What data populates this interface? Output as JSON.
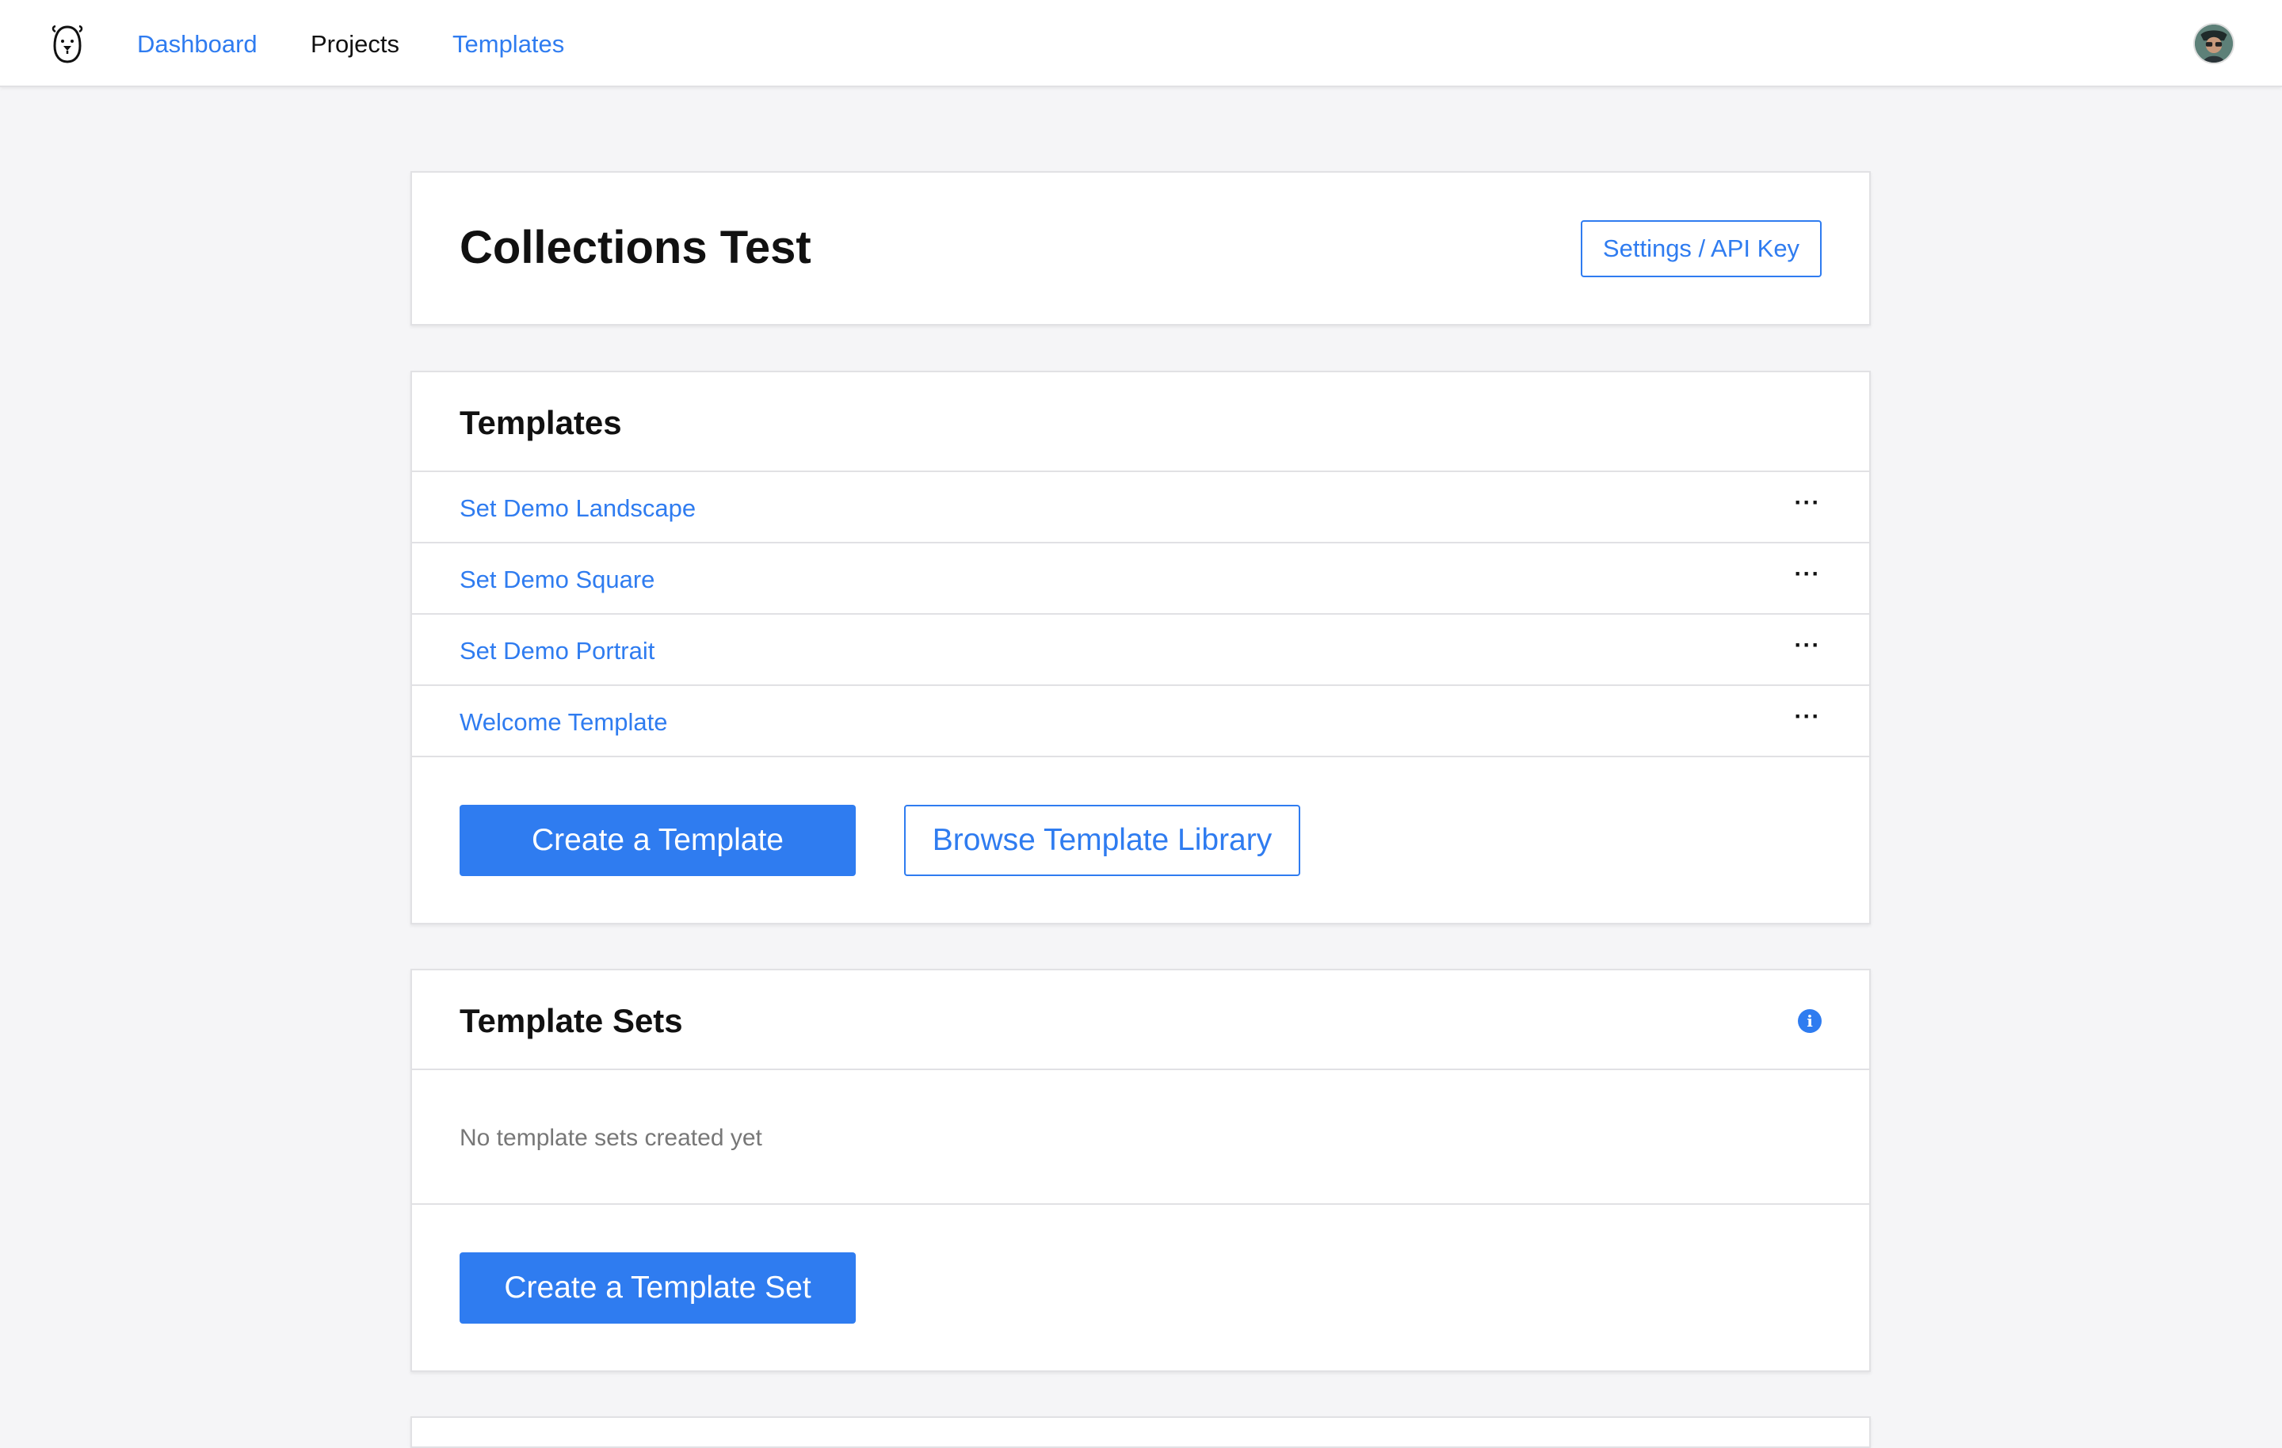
{
  "nav": {
    "items": [
      {
        "label": "Dashboard"
      },
      {
        "label": "Projects"
      },
      {
        "label": "Templates"
      }
    ],
    "logo_icon": "bear-logo-icon",
    "avatar_icon": "user-avatar-icon"
  },
  "project": {
    "title": "Collections Test",
    "settings_label": "Settings / API Key"
  },
  "templates": {
    "title": "Templates",
    "items": [
      {
        "name": "Set Demo Landscape",
        "menu": "···"
      },
      {
        "name": "Set Demo Square",
        "menu": "···"
      },
      {
        "name": "Set Demo Portrait",
        "menu": "···"
      },
      {
        "name": "Welcome Template",
        "menu": "···"
      }
    ],
    "create_label": "Create a Template",
    "browse_label": "Browse Template Library"
  },
  "template_sets": {
    "title": "Template Sets",
    "info_glyph": "i",
    "empty_text": "No template sets created yet",
    "create_label": "Create a Template Set"
  },
  "colors": {
    "accent": "#2f7cf0",
    "background": "#f5f5f7",
    "border": "#e1e1e4"
  }
}
